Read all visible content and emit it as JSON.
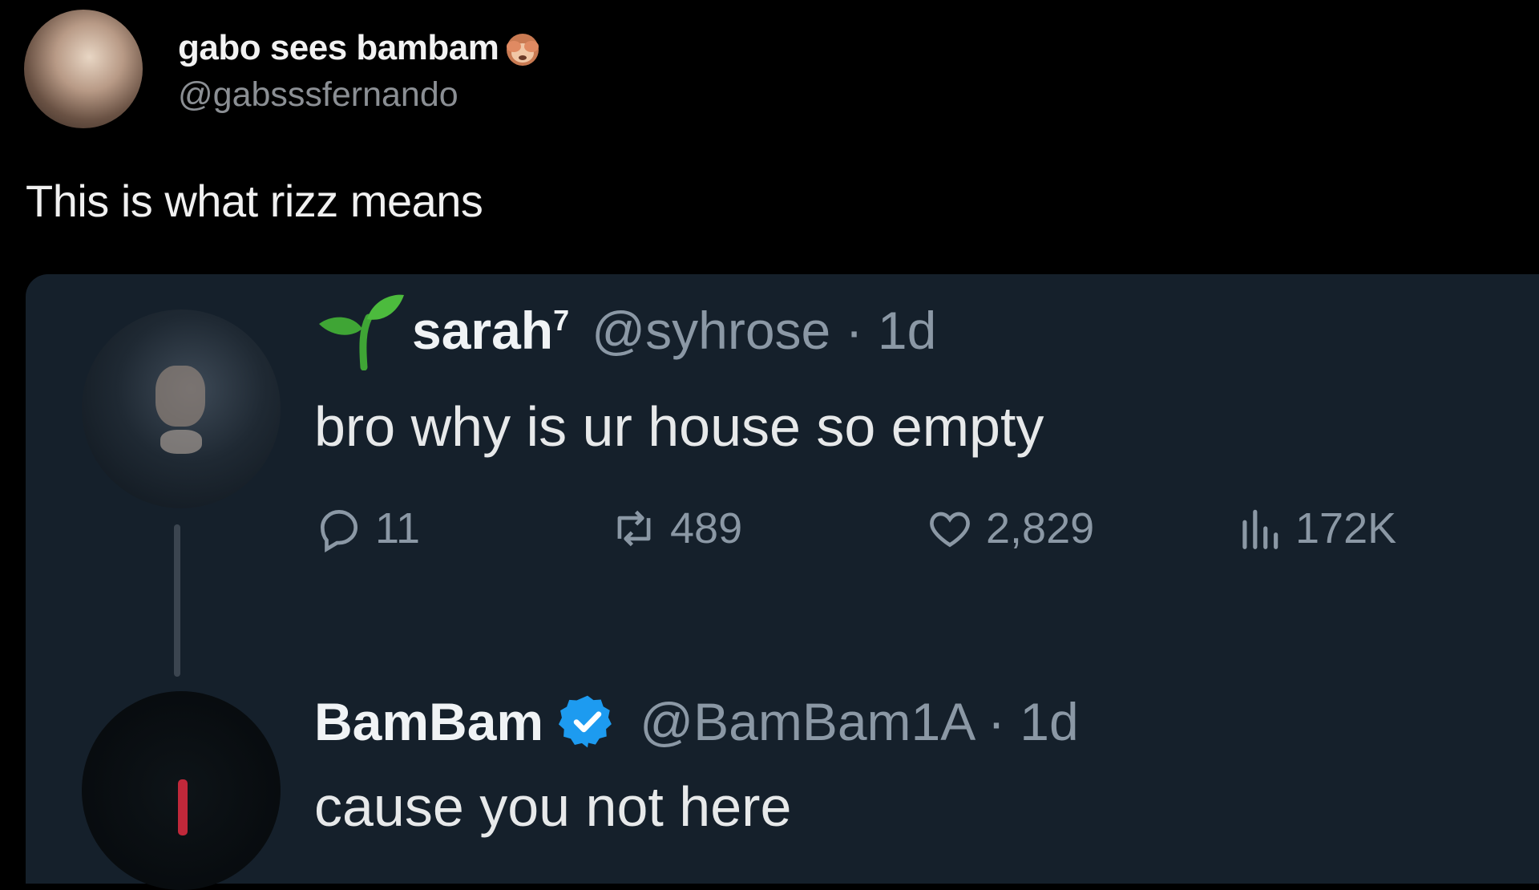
{
  "outer_tweet": {
    "author_name": "gabo sees bambam",
    "author_emoji": "see-no-evil-monkey-icon",
    "author_handle": "@gabsssfernando",
    "text": "This is what rizz means"
  },
  "quoted_thread": {
    "tweet1": {
      "emoji": "seedling-icon",
      "name": "sarah",
      "name_superscript": "7",
      "meta": "@syhrose · 1d",
      "text": "bro why is ur house so empty",
      "stats": {
        "replies": "11",
        "retweets": "489",
        "likes": "2,829",
        "views": "172K"
      }
    },
    "tweet2": {
      "name": "BamBam",
      "verified": true,
      "meta": "@BamBam1A · 1d",
      "text": "cause you not here"
    }
  },
  "colors": {
    "background": "#000000",
    "card_background": "#15202b",
    "muted_text": "#8b98a5",
    "verified_blue": "#1d9bf0",
    "sprout_green": "#3fa535"
  }
}
